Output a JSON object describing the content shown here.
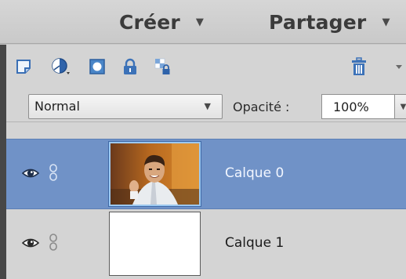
{
  "menubar": {
    "create": {
      "label": "Créer",
      "caret": "▼"
    },
    "share": {
      "label": "Partager",
      "caret": "▼"
    }
  },
  "toolbar": {
    "icons": [
      "new-layer-icon",
      "new-fill-adjustment-layer-icon",
      "add-layer-mask-icon",
      "lock-icon",
      "lock-transparent-pixels-icon",
      "trash-icon",
      "panel-menu-icon"
    ]
  },
  "blend": {
    "mode": "Normal",
    "arrow": "▼",
    "opacity_label": "Opacité :",
    "opacity_value": "100%",
    "opacity_arrow": "▼"
  },
  "layers": [
    {
      "name": "Calque 0",
      "selected": true,
      "thumbnail": "photo"
    },
    {
      "name": "Calque 1",
      "selected": false,
      "thumbnail": "blank-white"
    }
  ],
  "colors": {
    "selected_row": "#7092c7",
    "panel_bg": "#d4d4d4",
    "menubar_bg": "#d0d0d0",
    "accent_blue": "#4a86c8"
  }
}
